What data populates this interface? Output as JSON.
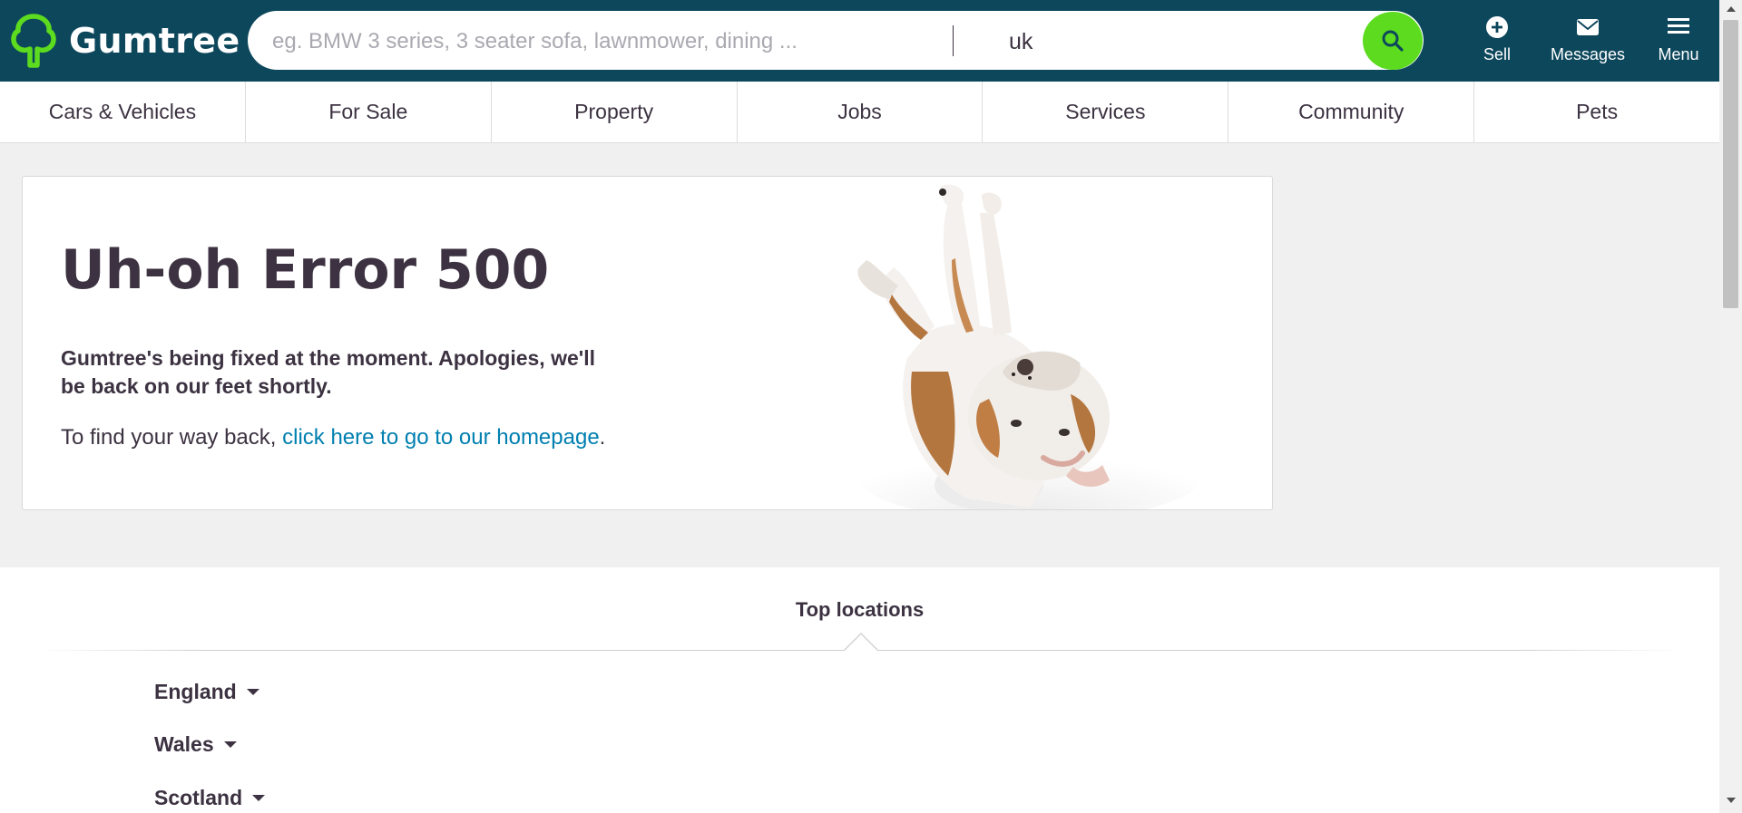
{
  "header": {
    "logo_text": "Gumtree",
    "search_placeholder": "eg. BMW 3 series, 3 seater sofa, lawnmower, dining ...",
    "location_value": "uk",
    "actions": {
      "sell": "Sell",
      "messages": "Messages",
      "menu": "Menu"
    }
  },
  "categories": [
    "Cars & Vehicles",
    "For Sale",
    "Property",
    "Jobs",
    "Services",
    "Community",
    "Pets"
  ],
  "error": {
    "title": "Uh-oh Error 500",
    "message": "Gumtree's being fixed at the moment. Apologies, we'll be back on our feet shortly.",
    "back_prefix": "To find your way back, ",
    "back_link": "click here to go to our homepage",
    "back_suffix": "."
  },
  "locations": {
    "heading": "Top locations",
    "regions": [
      "England",
      "Wales",
      "Scotland"
    ]
  },
  "colors": {
    "header_bg": "#0d475c",
    "brand_green": "#5cdb1f",
    "text": "#3c3241",
    "link": "#007fb0"
  },
  "icons": {
    "logo": "tree-logo-icon",
    "search": "search-icon",
    "sell": "plus-circle-icon",
    "messages": "envelope-icon",
    "menu": "hamburger-icon",
    "region_toggle": "caret-down-icon"
  }
}
